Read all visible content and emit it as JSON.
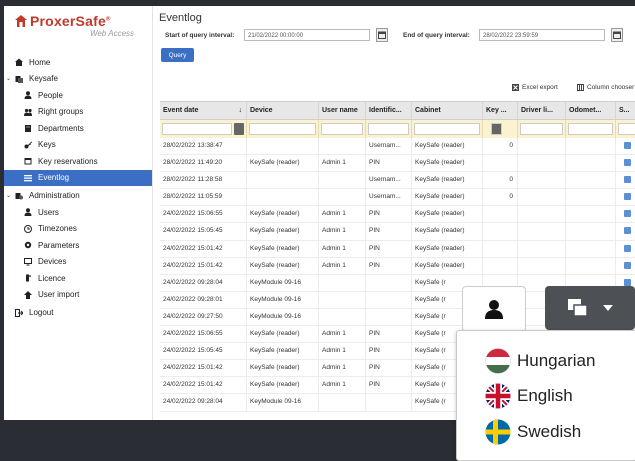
{
  "brand": {
    "name": "ProxerSafe",
    "mark": "®",
    "subtitle": "Web Access",
    "color": "#c0392b"
  },
  "sidebar": {
    "items": [
      {
        "label": "Home",
        "icon": "home-icon",
        "level": 0,
        "toggle": ""
      },
      {
        "label": "Keysafe",
        "icon": "keysafe-icon",
        "level": 0,
        "toggle": "⌄"
      },
      {
        "label": "People",
        "icon": "person-icon",
        "level": 1,
        "toggle": ""
      },
      {
        "label": "Right groups",
        "icon": "group-icon",
        "level": 1,
        "toggle": ""
      },
      {
        "label": "Departments",
        "icon": "building-icon",
        "level": 1,
        "toggle": ""
      },
      {
        "label": "Keys",
        "icon": "key-icon",
        "level": 1,
        "toggle": ""
      },
      {
        "label": "Key reservations",
        "icon": "calendar-icon",
        "level": 1,
        "toggle": ""
      },
      {
        "label": "Eventlog",
        "icon": "list-icon",
        "level": 1,
        "toggle": "",
        "active": true
      },
      {
        "label": "Administration",
        "icon": "admin-icon",
        "level": 0,
        "toggle": "⌄"
      },
      {
        "label": "Users",
        "icon": "person-icon",
        "level": 1,
        "toggle": ""
      },
      {
        "label": "Timezones",
        "icon": "clock-icon",
        "level": 1,
        "toggle": ""
      },
      {
        "label": "Parameters",
        "icon": "gear-icon",
        "level": 1,
        "toggle": ""
      },
      {
        "label": "Devices",
        "icon": "monitor-icon",
        "level": 1,
        "toggle": ""
      },
      {
        "label": "Licence",
        "icon": "licence-icon",
        "level": 1,
        "toggle": ""
      },
      {
        "label": "User import",
        "icon": "import-icon",
        "level": 1,
        "toggle": ""
      },
      {
        "label": "Logout",
        "icon": "logout-icon",
        "level": 0,
        "toggle": ""
      }
    ]
  },
  "page": {
    "title": "Eventlog",
    "start_label": "Start of query interval:",
    "start_value": "21/02/2022 00:00:00",
    "end_label": "End of query interval:",
    "end_value": "28/02/2022 23:59:59",
    "query_label": "Query",
    "excel_label": "Excel export",
    "column_chooser_label": "Column chooser"
  },
  "table": {
    "columns": [
      "Event date",
      "Device",
      "User name",
      "Identific...",
      "Cabinet",
      "Key ...",
      "Driver li...",
      "Odomet...",
      "S..."
    ],
    "sort_glyph": "↓",
    "rows": [
      [
        "28/02/2022 13:38:47",
        "",
        "",
        "Usernam...",
        "KeySafe (reader)",
        "0",
        "",
        "",
        ""
      ],
      [
        "28/02/2022 11:49:20",
        "KeySafe (reader)",
        "Admin 1",
        "PIN",
        "KeySafe (reader)",
        "",
        "",
        "",
        ""
      ],
      [
        "28/02/2022 11:28:58",
        "",
        "",
        "Usernam...",
        "KeySafe (reader)",
        "0",
        "",
        "",
        ""
      ],
      [
        "28/02/2022 11:05:59",
        "",
        "",
        "Usernam...",
        "KeySafe (reader)",
        "0",
        "",
        "",
        ""
      ],
      [
        "24/02/2022 15:06:55",
        "KeySafe (reader)",
        "Admin 1",
        "PIN",
        "KeySafe (reader)",
        "",
        "",
        "",
        ""
      ],
      [
        "24/02/2022 15:05:45",
        "KeySafe (reader)",
        "Admin 1",
        "PIN",
        "KeySafe (reader)",
        "",
        "",
        "",
        ""
      ],
      [
        "24/02/2022 15:01:42",
        "KeySafe (reader)",
        "Admin 1",
        "PIN",
        "KeySafe (reader)",
        "",
        "",
        "",
        ""
      ],
      [
        "24/02/2022 15:01:42",
        "KeySafe (reader)",
        "Admin 1",
        "PIN",
        "KeySafe (reader)",
        "",
        "",
        "",
        ""
      ],
      [
        "24/02/2022 09:28:04",
        "KeyModule 09-16",
        "",
        "",
        "KeySafe (r",
        "",
        "",
        "",
        ""
      ],
      [
        "24/02/2022 09:28:01",
        "KeyModule 09-16",
        "",
        "",
        "KeySafe (r",
        "",
        "",
        "",
        ""
      ],
      [
        "24/02/2022 09:27:50",
        "KeyModule 09-16",
        "",
        "",
        "KeySafe (r",
        "",
        "",
        "",
        ""
      ],
      [
        "24/02/2022 15:06:55",
        "KeySafe (reader)",
        "Admin 1",
        "PIN",
        "KeySafe (r",
        "",
        "",
        "",
        ""
      ],
      [
        "24/02/2022 15:05:45",
        "KeySafe (reader)",
        "Admin 1",
        "PIN",
        "KeySafe (r",
        "",
        "",
        "",
        ""
      ],
      [
        "24/02/2022 15:01:42",
        "KeySafe (reader)",
        "Admin 1",
        "PIN",
        "KeySafe (r",
        "",
        "",
        "",
        ""
      ],
      [
        "24/02/2022 15:01:42",
        "KeySafe (reader)",
        "Admin 1",
        "PIN",
        "KeySafe (r",
        "",
        "",
        "",
        ""
      ],
      [
        "24/02/2022 09:28:04",
        "KeyModule 09-16",
        "",
        "",
        "KeySafe (r",
        "",
        "",
        "",
        ""
      ]
    ]
  },
  "overlay": {
    "languages": [
      {
        "label": "Hungarian",
        "flag": "hungary-flag-icon"
      },
      {
        "label": "English",
        "flag": "uk-flag-icon"
      },
      {
        "label": "Swedish",
        "flag": "sweden-flag-icon"
      }
    ],
    "user_icon": "user-icon",
    "language_icon": "language-icon",
    "accent": "#3a6fc4"
  }
}
